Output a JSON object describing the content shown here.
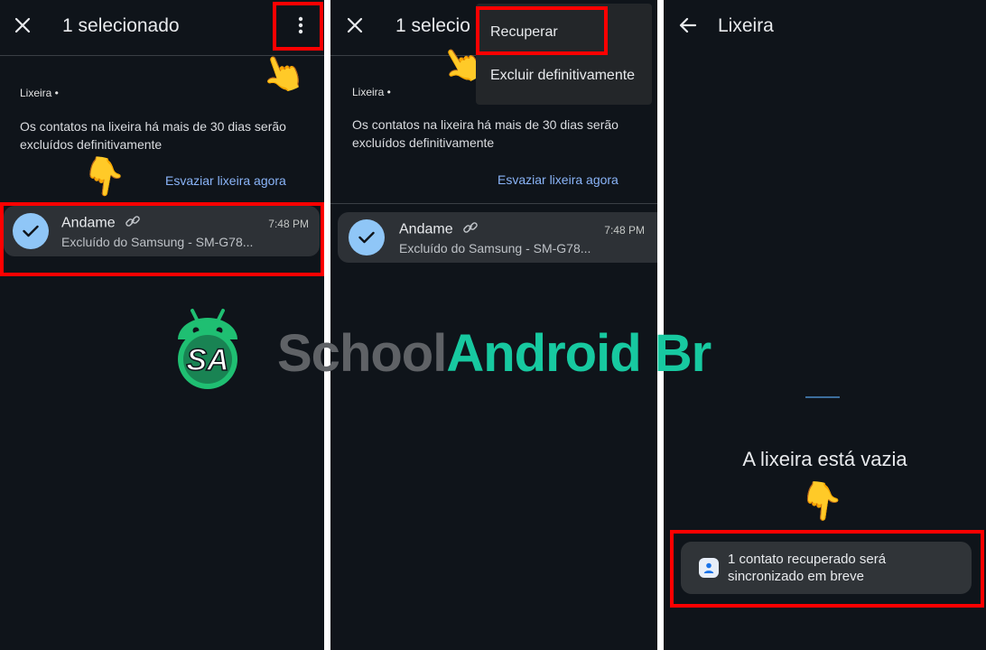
{
  "colors": {
    "background": "#0f141a",
    "accent_link": "#8ab4f8",
    "highlight": "#ff0000",
    "card": "#2d3136",
    "avatar": "#8fc6f7",
    "watermark_green": "#17c9a0",
    "watermark_gray": "#5f6266"
  },
  "panel1": {
    "close_icon": "close-icon",
    "title": "1 selecionado",
    "more_icon": "more-vert-icon",
    "section_label": "Lixeira •",
    "info_text": "Os contatos na lixeira há mais de 30 dias serão excluídos definitivamente",
    "empty_now": "Esvaziar lixeira agora",
    "contact": {
      "name": "Andame",
      "subtitle": "Excluído do Samsung - SM-G78...",
      "time": "7:48 PM"
    }
  },
  "panel2": {
    "title": "1 selecio",
    "section_label": "Lixeira •",
    "info_text": "Os contatos na lixeira há mais de 30 dias serão excluídos definitivamente",
    "empty_now": "Esvaziar lixeira agora",
    "contact": {
      "name": "Andame",
      "subtitle": "Excluído do Samsung - SM-G78...",
      "time": "7:48 PM"
    },
    "menu": {
      "recover": "Recuperar",
      "delete_forever": "Excluir definitivamente"
    }
  },
  "panel3": {
    "back_icon": "arrow-back-icon",
    "title": "Lixeira",
    "empty_message": "A lixeira está vazia",
    "snackbar": "1 contato recuperado será sincronizado em breve"
  },
  "watermark": {
    "school": "School",
    "android": "Android",
    "br": "Br",
    "logo_text": "SA"
  }
}
